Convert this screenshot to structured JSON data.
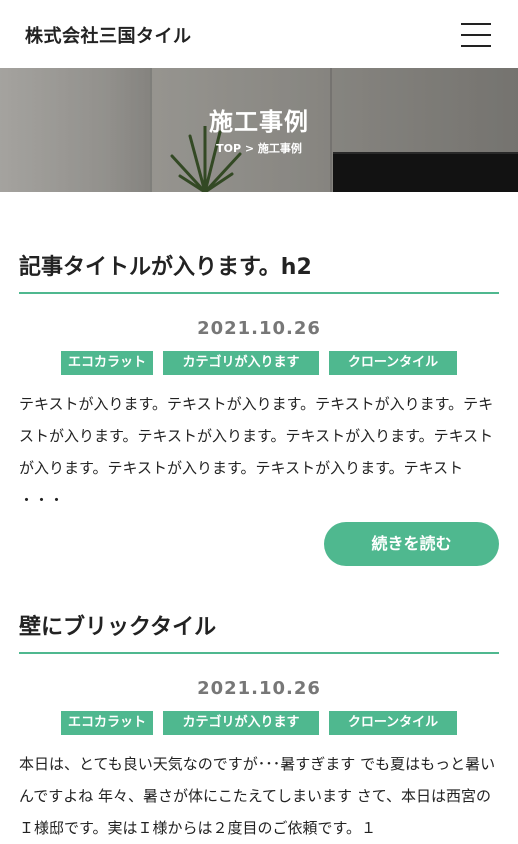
{
  "header": {
    "logo": "株式会社三国タイル"
  },
  "hero": {
    "title": "施工事例",
    "breadcrumb": "TOP > 施工事例"
  },
  "posts": [
    {
      "title": "記事タイトルが入ります。h2",
      "date": "2021.10.26",
      "tags": [
        "エコカラット",
        "カテゴリが入ります",
        "クローンタイル"
      ],
      "body": "テキストが入ります。テキストが入ります。テキストが入ります。テキストが入ります。テキストが入ります。テキストが入ります。テキストが入ります。テキストが入ります。テキストが入ります。テキスト ・・・",
      "read_more": "続きを読む"
    },
    {
      "title": "壁にブリックタイル",
      "date": "2021.10.26",
      "tags": [
        "エコカラット",
        "カテゴリが入ります",
        "クローンタイル"
      ],
      "body": "本日は、とても良い天気なのですが･･･暑すぎます でも夏はもっと暑いんですよね 年々、暑さが体にこたえてしまいます さて、本日は西宮のＩ様邸です。実はＩ様からは２度目のご依頼です。１"
    }
  ],
  "colors": {
    "accent": "#4fb88f"
  }
}
